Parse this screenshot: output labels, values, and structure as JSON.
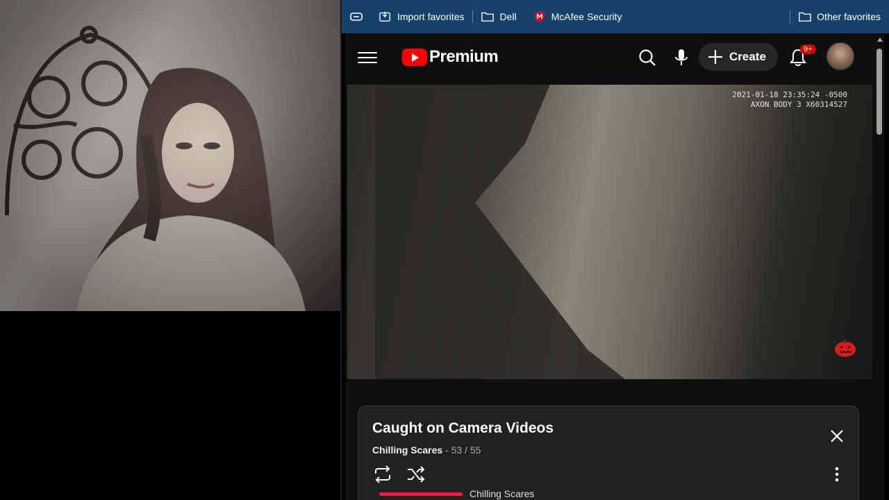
{
  "favorites": {
    "items": [
      {
        "label": "Import favorites",
        "icon": "import-icon"
      },
      {
        "label": "Dell",
        "icon": "folder-icon"
      },
      {
        "label": "McAfee Security",
        "icon": "mcafee-shield-icon"
      }
    ],
    "other": {
      "label": "Other favorites",
      "icon": "folder-icon"
    }
  },
  "youtube": {
    "logo_text": "Premium",
    "create_label": "Create",
    "notification_badge": "9+",
    "video": {
      "timestamp_line1": "2021-01-18 23:35:24 -0500",
      "timestamp_line2": "AXON BODY 3 X60314527"
    },
    "playlist": {
      "title": "Caught on Camera Videos",
      "channel": "Chilling Scares",
      "position": "- 53 / 55",
      "next_item_channel": "Chilling Scares"
    }
  },
  "colors": {
    "favbar_bg": "#16416a",
    "yt_bg": "#0f0f0f",
    "brand_red": "#ff0000"
  }
}
